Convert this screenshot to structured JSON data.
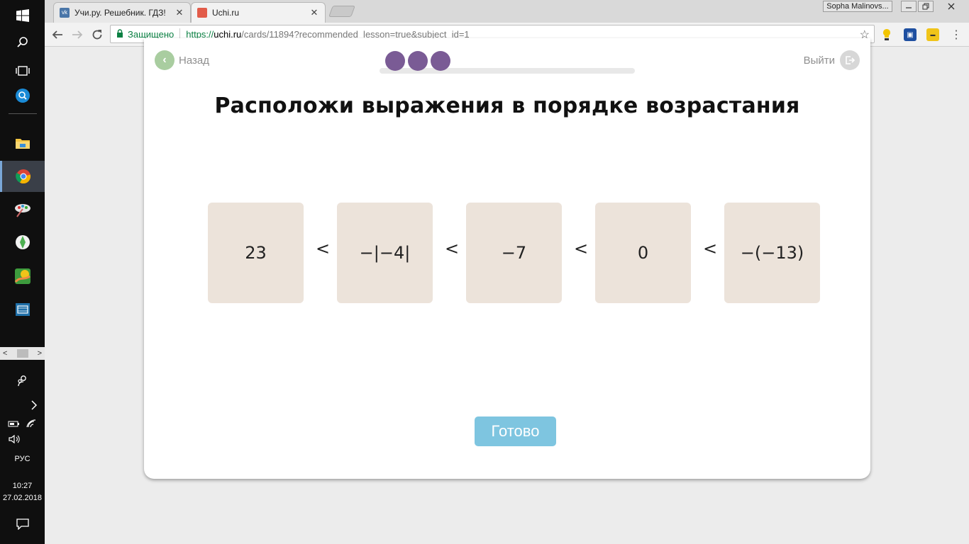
{
  "taskbar": {
    "lang": "РУС",
    "time": "10:27",
    "date": "27.02.2018"
  },
  "browser": {
    "tabs": [
      {
        "title": "Учи.ру. Решебник. ГДЗ!",
        "active": false
      },
      {
        "title": "Uchi.ru",
        "active": true
      }
    ],
    "profile": "Sopha Malinovs...",
    "secure_label": "Защищено",
    "url_scheme": "https://",
    "url_host": "uchi.ru",
    "url_rest": "/cards/11894?recommended_lesson=true&subject_id=1"
  },
  "lesson": {
    "back_label": "Назад",
    "exit_label": "Выйти",
    "progress_steps_done": 3,
    "title": "Расположи выражения в порядке возрастания",
    "tiles": [
      "23",
      "−|−4|",
      "−7",
      "0",
      "−(−13)"
    ],
    "separator": "<",
    "done_label": "Готово"
  },
  "colors": {
    "accent_purple": "#7a5b95",
    "back_green": "#a9cda0",
    "tile_bg": "#ece3da",
    "done_button": "#7ec5e0"
  }
}
